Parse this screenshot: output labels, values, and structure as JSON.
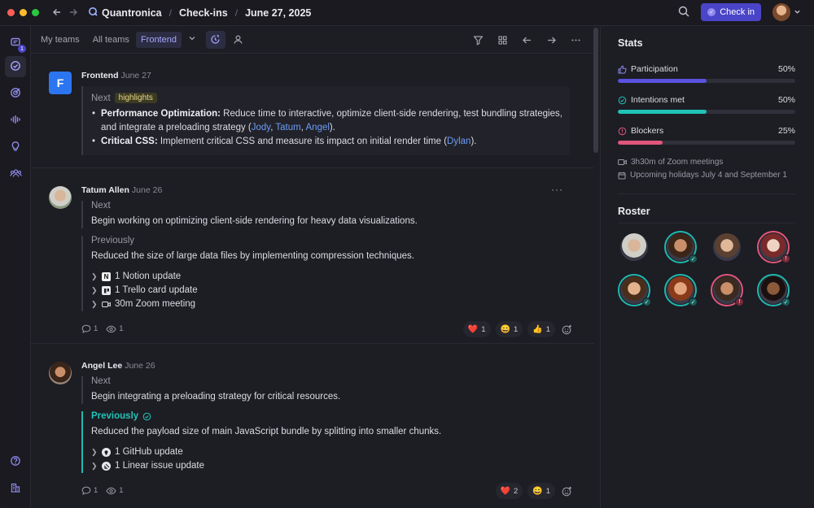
{
  "titlebar": {
    "brand": "Quantronica",
    "crumbs": [
      "Check-ins",
      "June 27, 2025"
    ],
    "checkin_label": "Check in",
    "colors": {
      "red": "#ff5f57",
      "yellow": "#febc2e",
      "green": "#28c840",
      "accent": "#4a45c8"
    }
  },
  "rail": {
    "items": [
      "inbox-icon",
      "checkins-icon",
      "goals-icon",
      "pulse-icon",
      "ideas-icon",
      "team-icon"
    ],
    "inbox_badge": "1",
    "bottom": [
      "help-icon",
      "org-icon"
    ]
  },
  "toolbar": {
    "tabs": [
      "My teams",
      "All teams",
      "Frontend"
    ],
    "active_tab": "Frontend"
  },
  "feed": [
    {
      "author": "Frontend",
      "initial": "F",
      "date": "June 27",
      "section_label": "Next",
      "chip": "highlights",
      "bullets": [
        {
          "bold": "Performance Optimization:",
          "text": " Reduce time to interactive, optimize client-side rendering, test bundling strategies, and integrate a preloading strategy (",
          "links": [
            "Jody",
            "Tatum",
            "Angel"
          ],
          "tail": ")."
        },
        {
          "bold": "Critical CSS:",
          "text": " Implement critical CSS and measure its impact on initial render time (",
          "links": [
            "Dylan"
          ],
          "tail": ")."
        }
      ]
    },
    {
      "author": "Tatum Allen",
      "date": "June 26",
      "next_label": "Next",
      "next_text": "Begin working on optimizing client-side rendering for heavy data visualizations.",
      "prev_label": "Previously",
      "prev_text": "Reduced the size of large data files by implementing compression techniques.",
      "updates": [
        "1 Notion update",
        "1 Trello card update",
        "30m Zoom meeting"
      ],
      "comments": "1",
      "views": "1",
      "reactions": [
        {
          "emoji": "❤️",
          "count": "1"
        },
        {
          "emoji": "😄",
          "count": "1"
        },
        {
          "emoji": "👍",
          "count": "1"
        }
      ]
    },
    {
      "author": "Angel Lee",
      "date": "June 26",
      "next_label": "Next",
      "next_text": "Begin integrating a preloading strategy for critical resources.",
      "prev_label": "Previously",
      "prev_text": "Reduced the payload size of main JavaScript bundle by splitting into smaller chunks.",
      "updates": [
        "1 GitHub update",
        "1 Linear issue update"
      ],
      "comments": "1",
      "views": "1",
      "reactions": [
        {
          "emoji": "❤️",
          "count": "2"
        },
        {
          "emoji": "😄",
          "count": "1"
        }
      ]
    }
  ],
  "stats": {
    "title": "Stats",
    "items": [
      {
        "label": "Participation",
        "value": "50%",
        "fraction": 0.5,
        "color": "#5a52e0"
      },
      {
        "label": "Intentions met",
        "value": "50%",
        "fraction": 0.5,
        "color": "#1fc4b8"
      },
      {
        "label": "Blockers",
        "value": "25%",
        "fraction": 0.25,
        "color": "#e0567a"
      }
    ],
    "zoom": "3h30m of Zoom meetings",
    "holidays": "Upcoming holidays July 4 and September 1"
  },
  "roster": {
    "title": "Roster",
    "people": [
      {
        "ring": "none",
        "status": "none",
        "skin": "#d9b59a",
        "hair": "#cfcfc8"
      },
      {
        "ring": "teal",
        "status": "ok",
        "skin": "#c98f6a",
        "hair": "#3a2518"
      },
      {
        "ring": "none",
        "status": "none",
        "skin": "#e0b899",
        "hair": "#5a4030"
      },
      {
        "ring": "pink",
        "status": "warn",
        "skin": "#f0d3c3",
        "hair": "#7a2a2a"
      },
      {
        "ring": "teal",
        "status": "ok",
        "skin": "#e4b38e",
        "hair": "#4a2e1c"
      },
      {
        "ring": "teal",
        "status": "ok",
        "skin": "#e3a47e",
        "hair": "#8a3a1a"
      },
      {
        "ring": "pink",
        "status": "warn",
        "skin": "#c98f6a",
        "hair": "#3a2a20"
      },
      {
        "ring": "teal",
        "status": "ok",
        "skin": "#8a5a3a",
        "hair": "#1a1010"
      }
    ]
  }
}
